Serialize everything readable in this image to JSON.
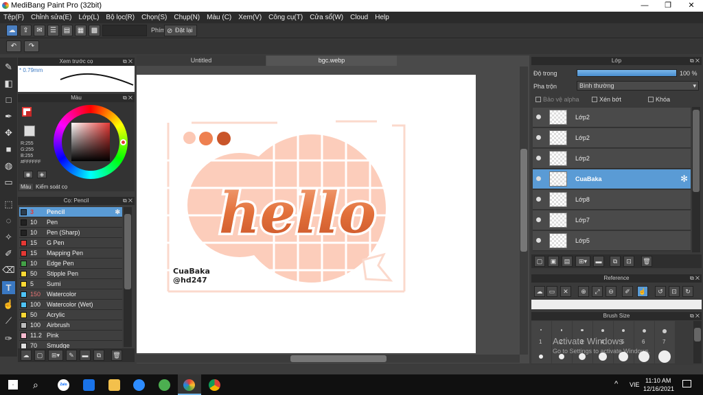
{
  "app": {
    "title": "MediBang Paint Pro (32bit)"
  },
  "menu": [
    "Tệp(F)",
    "Chỉnh sửa(E)",
    "Lớp(L)",
    "Bộ lọc(R)",
    "Chọn(S)",
    "Chụp(N)",
    "Màu (C)",
    "Xem(V)",
    "Công cụ(T)",
    "Cửa sổ(W)",
    "Cloud",
    "Help"
  ],
  "toolbar": {
    "phim_label": "Phím",
    "reset_label": "Đặt lại"
  },
  "preview_panel": {
    "title": "Xem trước cọ",
    "size": "0.79mm"
  },
  "color_panel": {
    "title": "Màu",
    "r": "R:255",
    "g": "G:255",
    "b": "B:255",
    "hex": "#FFFFFF",
    "tab_color": "Màu",
    "tab_control": "Kiểm soát cọ"
  },
  "brush_panel": {
    "title": "Cọ: Pencil",
    "brushes": [
      {
        "size": "3",
        "name": "Pencil",
        "color": "#2c3e50"
      },
      {
        "size": "10",
        "name": "Pen",
        "color": "#222222"
      },
      {
        "size": "10",
        "name": "Pen (Sharp)",
        "color": "#222222"
      },
      {
        "size": "15",
        "name": "G Pen",
        "color": "#e53935"
      },
      {
        "size": "15",
        "name": "Mapping Pen",
        "color": "#e53935"
      },
      {
        "size": "10",
        "name": "Edge Pen",
        "color": "#43a047"
      },
      {
        "size": "50",
        "name": "Stipple Pen",
        "color": "#fdd835"
      },
      {
        "size": "5",
        "name": "Sumi",
        "color": "#fdd835"
      },
      {
        "size": "150",
        "name": "Watercolor",
        "color": "#4fc3f7"
      },
      {
        "size": "100",
        "name": "Watercolor (Wet)",
        "color": "#4fc3f7"
      },
      {
        "size": "50",
        "name": "Acrylic",
        "color": "#fdd835"
      },
      {
        "size": "100",
        "name": "Airbrush",
        "color": "#bdbdbd"
      },
      {
        "size": "11.2",
        "name": "Pink",
        "color": "#f8bbd0"
      },
      {
        "size": "70",
        "name": "Smudge",
        "color": "#e0e0e0"
      }
    ]
  },
  "doc_tabs": [
    "Untitled",
    "bgc.webp"
  ],
  "canvas": {
    "title": "hello",
    "credit1": "CuaBaka",
    "credit2": "@hd247"
  },
  "layer_panel": {
    "title": "Lớp",
    "opacity_label": "Độ trong",
    "opacity_value": "100 %",
    "opacity_fraction": 1.0,
    "blend_label": "Pha trộn",
    "blend_value": "Bình thường",
    "protect_alpha": "Bảo vệ alpha",
    "clip": "Xén bớt",
    "lock": "Khóa",
    "layers": [
      {
        "name": "Lớp2",
        "selected": false
      },
      {
        "name": "Lớp2",
        "selected": false
      },
      {
        "name": "Lớp2",
        "selected": false
      },
      {
        "name": "CuaBaka",
        "selected": true
      },
      {
        "name": "Lớp8",
        "selected": false
      },
      {
        "name": "Lớp7",
        "selected": false
      },
      {
        "name": "Lớp5",
        "selected": false
      }
    ]
  },
  "reference_panel": {
    "title": "Reference"
  },
  "brush_size_panel": {
    "title": "Brush Size",
    "sizes": [
      "1",
      "2",
      "3",
      "4",
      "5",
      "6",
      "7"
    ]
  },
  "watermark": {
    "line1": "Activate Windows",
    "line2": "Go to Settings to activate Windows."
  },
  "taskbar": {
    "lang": "VIE",
    "time": "11:10 AM",
    "date": "12/16/2021",
    "zalo": "Zalo"
  },
  "colors": {
    "accent": "#5a9bd5",
    "peach": "#f9c9b6",
    "orange": "#e2703a"
  }
}
